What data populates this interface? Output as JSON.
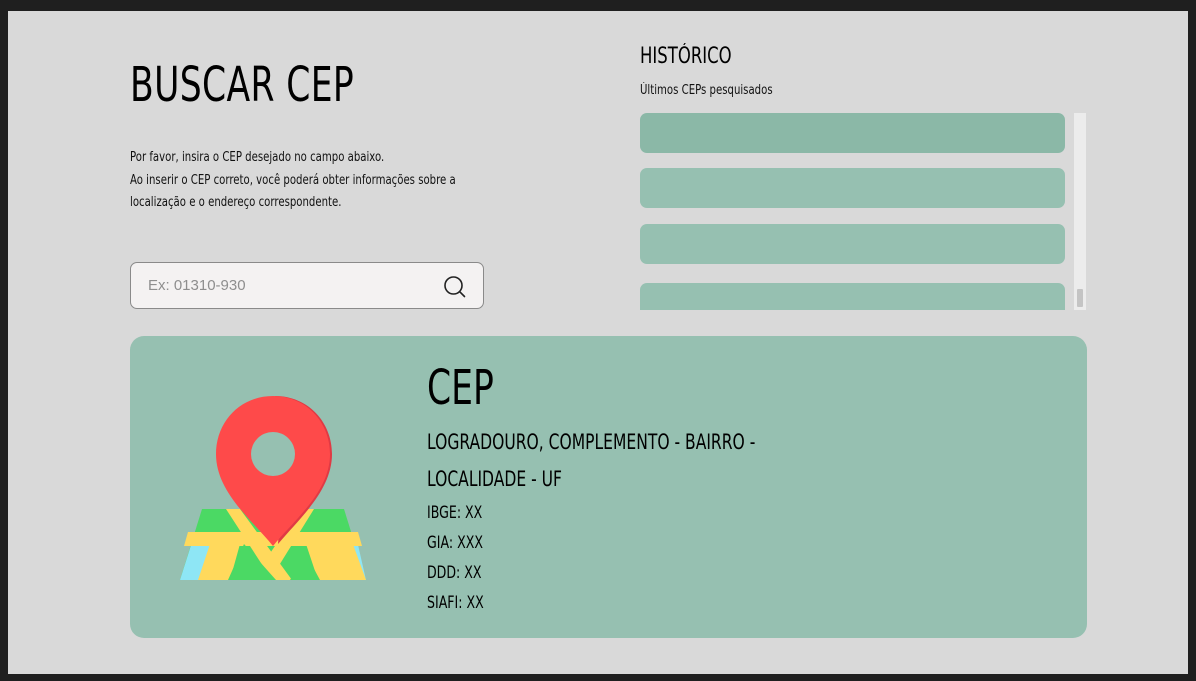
{
  "page": {
    "title": "BUSCAR CEP",
    "description": [
      "Por favor, insira o CEP desejado no campo abaixo.",
      "Ao inserir o CEP correto, você poderá obter informações sobre a",
      "localização e o endereço correspondente."
    ]
  },
  "search": {
    "placeholder": "Ex: 01310-930",
    "value": "",
    "icon": "search-icon"
  },
  "history": {
    "title": "HISTÓRICO",
    "subtitle": "Últimos CEPs pesquisados",
    "items": [
      "",
      "",
      "",
      ""
    ]
  },
  "result": {
    "cep": "CEP",
    "address_line1": "LOGRADOURO, COMPLEMENTO - BAIRRO -",
    "address_line2": "LOCALIDADE - UF",
    "ibge": "IBGE: XX",
    "gia": "GIA: XXX",
    "ddd": "DDD: XX",
    "siafi": "SIAFI: XX",
    "illustration": "map-pin-icon"
  },
  "colors": {
    "background": "#d9d9d9",
    "accent": "#96c0b1",
    "pin": "#fe4a4a",
    "map_green": "#4bd964",
    "map_yellow": "#ffd95c",
    "map_blue": "#8ee6f5"
  }
}
